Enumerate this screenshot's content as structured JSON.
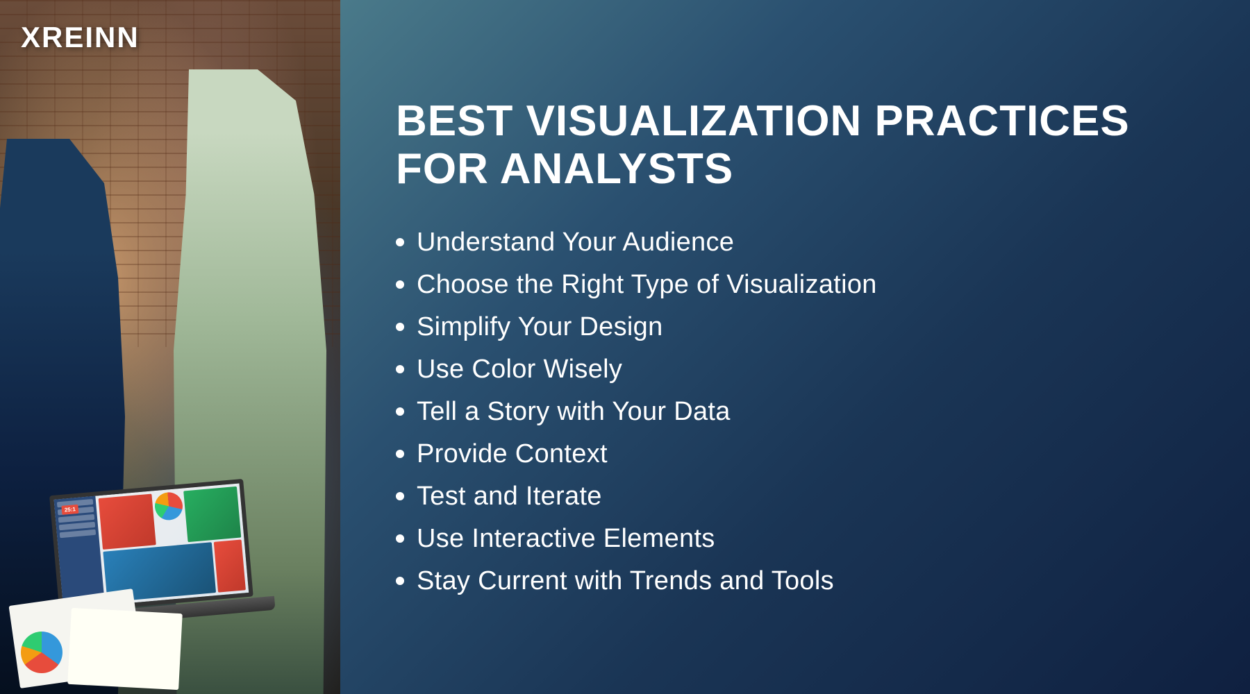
{
  "logo": {
    "text": "XREINN"
  },
  "right": {
    "title_line1": "BEST VISUALIZATION PRACTICES",
    "title_line2": "FOR ANALYSTS",
    "items": [
      {
        "text": "Understand Your Audience"
      },
      {
        "text": "Choose the Right Type of Visualization"
      },
      {
        "text": "Simplify Your Design"
      },
      {
        "text": "Use Color Wisely"
      },
      {
        "text": "Tell a Story with Your Data"
      },
      {
        "text": "Provide Context"
      },
      {
        "text": "Test and Iterate"
      },
      {
        "text": "Use Interactive Elements"
      },
      {
        "text": "Stay Current with Trends and Tools"
      }
    ]
  }
}
